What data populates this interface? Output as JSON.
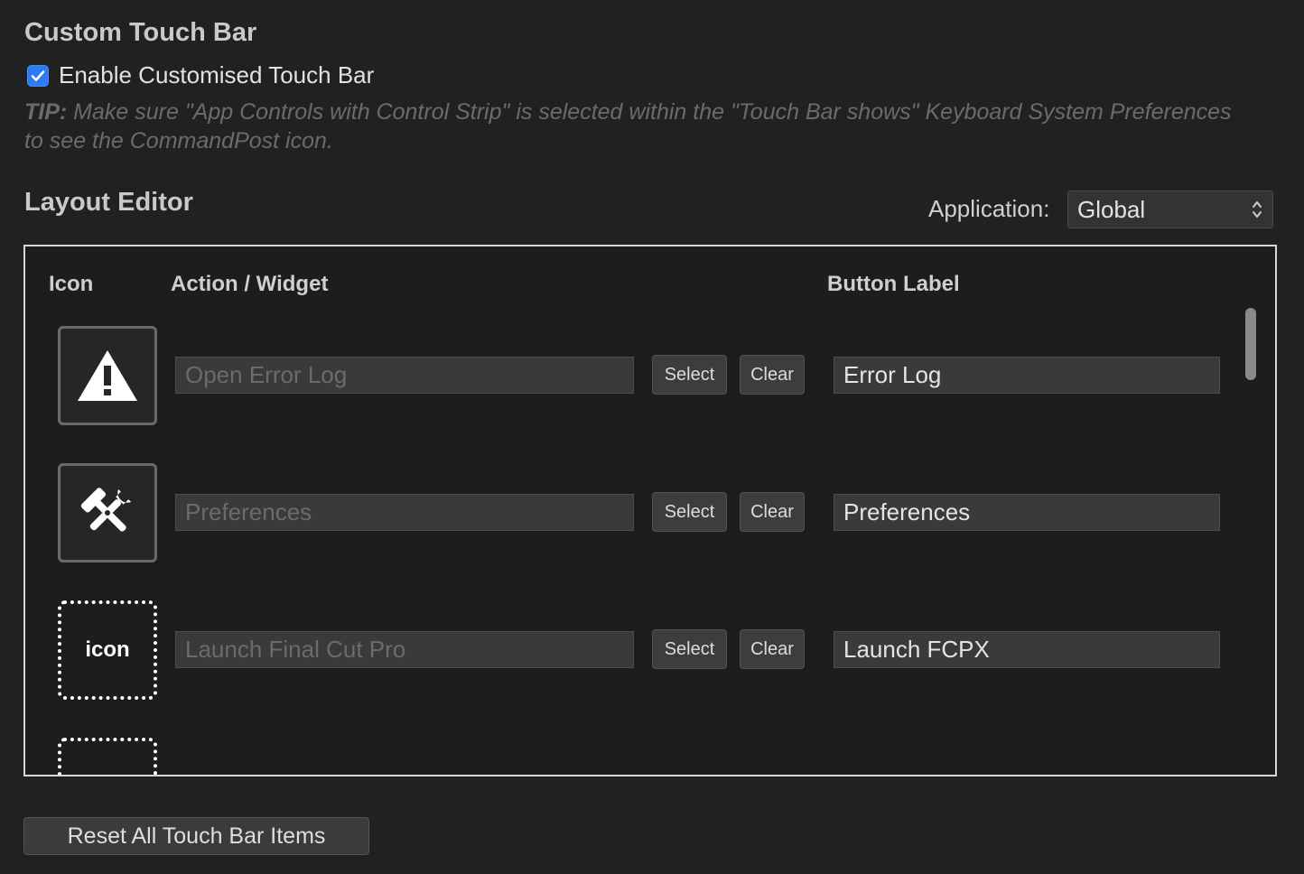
{
  "header": {
    "title": "Custom Touch Bar",
    "enable_label": "Enable Customised Touch Bar",
    "enable_checked": true,
    "tip_prefix": "TIP:",
    "tip_text": " Make sure \"App Controls with Control Strip\" is selected within the \"Touch Bar shows\" Keyboard System Preferences to see the CommandPost icon."
  },
  "layout_editor": {
    "title": "Layout Editor",
    "application_label": "Application:",
    "application_value": "Global",
    "columns": {
      "icon": "Icon",
      "action": "Action / Widget",
      "button_label": "Button Label"
    },
    "rows": [
      {
        "icon": "warning-icon",
        "icon_text": "",
        "action": "Open Error Log",
        "select_label": "Select",
        "clear_label": "Clear",
        "button_label": "Error Log"
      },
      {
        "icon": "tools-icon",
        "icon_text": "",
        "action": "Preferences",
        "select_label": "Select",
        "clear_label": "Clear",
        "button_label": "Preferences"
      },
      {
        "icon": "placeholder-icon",
        "icon_text": "icon",
        "action": "Launch Final Cut Pro",
        "select_label": "Select",
        "clear_label": "Clear",
        "button_label": "Launch FCPX"
      }
    ]
  },
  "footer": {
    "reset_label": "Reset All Touch Bar Items"
  },
  "colors": {
    "background": "#212121",
    "checkbox_accent": "#2f7bf6",
    "tip_text": "#6b6b6b"
  }
}
